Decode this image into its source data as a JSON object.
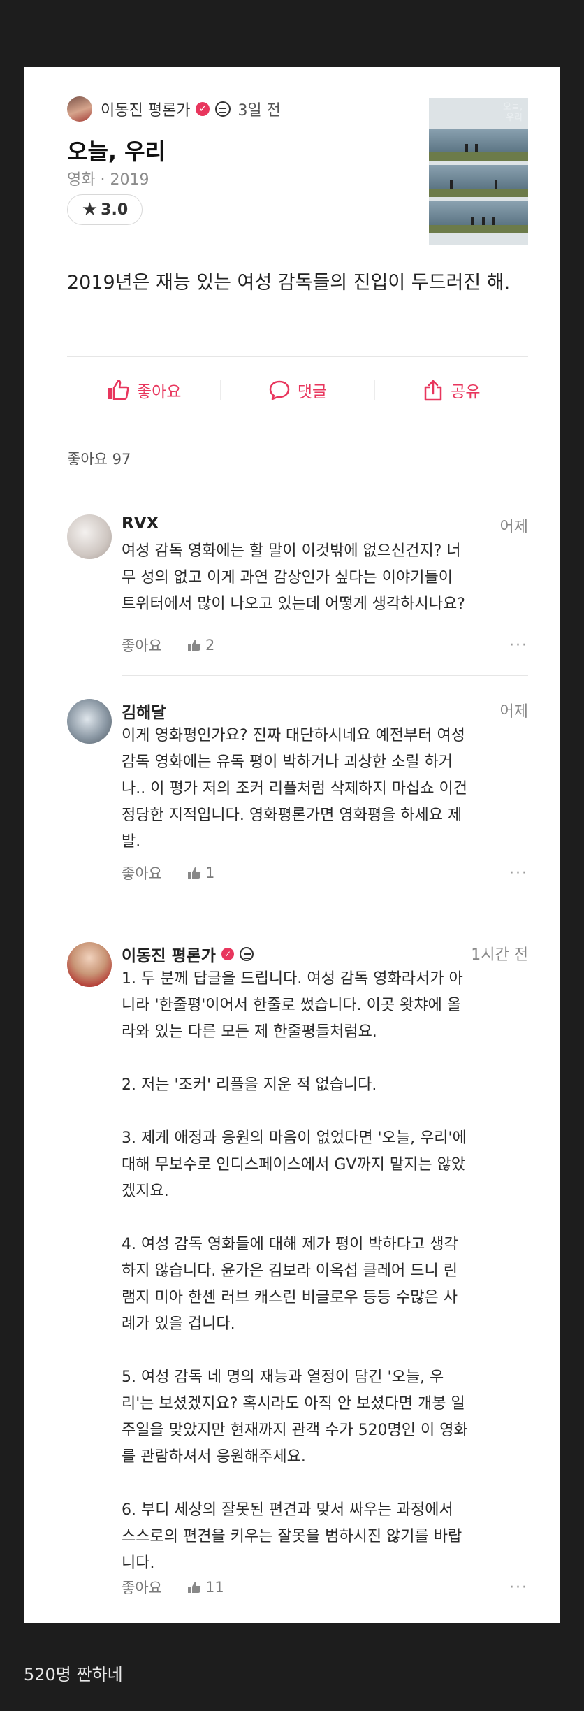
{
  "review": {
    "author": "이동진 평론가",
    "time": "3일 전",
    "movie_title": "오늘, 우리",
    "meta": "영화 · 2019",
    "rating": "3.0",
    "body": "2019년은 재능 있는 여성 감독들의 진입이 두드러진 해.",
    "poster_title_line1": "오늘,",
    "poster_title_line2": "우리"
  },
  "actions": {
    "like": "좋아요",
    "comment": "댓글",
    "share": "공유"
  },
  "like_count": "좋아요 97",
  "comments": [
    {
      "name": "RVX",
      "time": "어제",
      "body": "여성 감독 영화에는 할 말이 이것밖에 없으신건지? 너\n무 성의 없고 이게 과연 감상인가 싶다는 이야기들이\n트위터에서 많이 나오고 있는데 어떻게 생각하시나요?",
      "like_label": "좋아요",
      "likes": "2",
      "more": "···"
    },
    {
      "name": "김해달",
      "time": "어제",
      "body": "이게 영화평인가요? 진짜 대단하시네요 예전부터 여성\n감독 영화에는 유독 평이 박하거나 괴상한 소릴 하거\n나.. 이 평가 저의 조커 리플처럼 삭제하지 마십쇼 이건\n정당한 지적입니다. 영화평론가면 영화평을 하세요 제\n발.",
      "like_label": "좋아요",
      "likes": "1",
      "more": "···"
    },
    {
      "name": "이동진 평론가",
      "time": "1시간 전",
      "body": "1. 두 분께 답글을 드립니다.  여성 감독 영화라서가 아\n니라 '한줄평'이어서 한줄로 썼습니다. 이곳 왓챠에 올\n라와 있는 다른 모든 제 한줄평들처럼요.\n\n2. 저는 '조커' 리플을 지운 적 없습니다.\n\n3. 제게 애정과 응원의 마음이 없었다면 '오늘, 우리'에\n대해 무보수로 인디스페이스에서 GV까지 맡지는 않았\n겠지요.\n\n4. 여성 감독 영화들에 대해 제가 평이 박하다고 생각\n하지 않습니다. 윤가은 김보라 이옥섭 클레어 드니 린\n램지 미아 한센 러브 캐스린 비글로우 등등 수많은 사\n례가 있을 겁니다.\n\n5. 여성 감독 네 명의 재능과 열정이 담긴 '오늘, 우\n리'는 보셨겠지요? 혹시라도 아직 안 보셨다면 개봉 일\n주일을 맞았지만 현재까지 관객 수가 520명인 이 영화\n를 관람하셔서 응원해주세요.\n\n6. 부디 세상의 잘못된 편견과 맞서 싸우는 과정에서\n스스로의 편견을 키우는 잘못을  범하시진 않기를 바랍\n니다.",
      "like_label": "좋아요",
      "likes": "11",
      "more": "···"
    }
  ],
  "caption": "520명 짠하네",
  "colors": {
    "accent": "#e8365d",
    "background": "#1d1d1d",
    "card": "#ffffff"
  }
}
